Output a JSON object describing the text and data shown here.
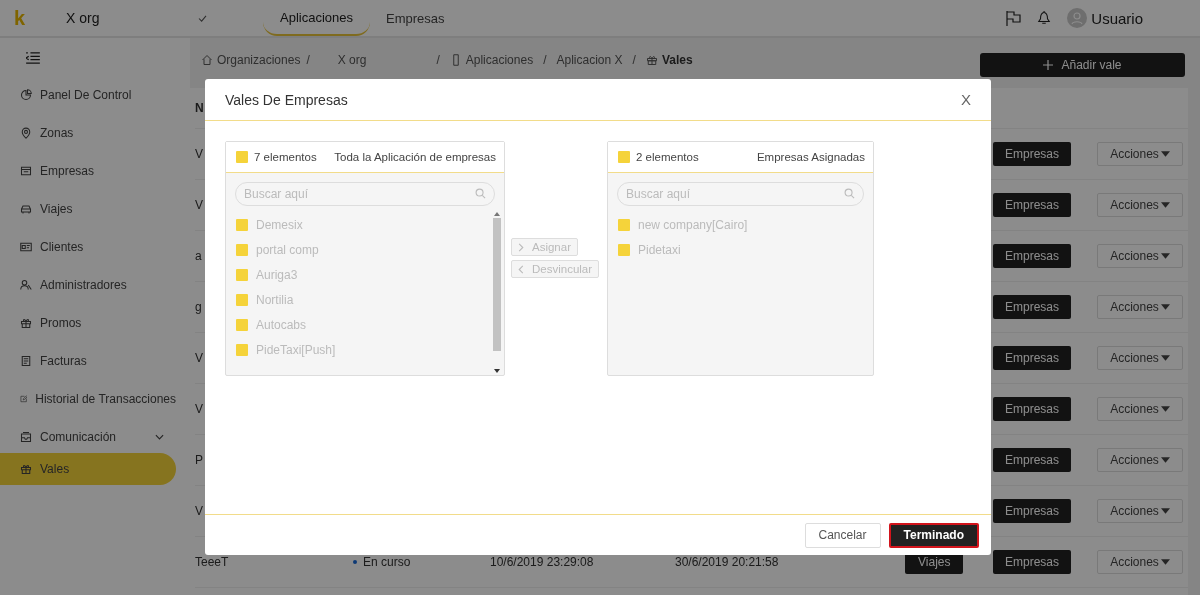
{
  "header": {
    "logo": "k",
    "org": "X org",
    "tabs": [
      {
        "label": "Aplicaciones",
        "selected": true
      },
      {
        "label": "Empresas",
        "selected": false
      }
    ],
    "user": "Usuario"
  },
  "sidebar": {
    "items": [
      {
        "label": "Panel De Control",
        "selected": false
      },
      {
        "label": "Zonas",
        "selected": false
      },
      {
        "label": "Empresas",
        "selected": false
      },
      {
        "label": "Viajes",
        "selected": false
      },
      {
        "label": "Clientes",
        "selected": false
      },
      {
        "label": "Administradores",
        "selected": false
      },
      {
        "label": "Promos",
        "selected": false
      },
      {
        "label": "Facturas",
        "selected": false
      },
      {
        "label": "Historial de Transacciones",
        "selected": false
      },
      {
        "label": "Comunicación",
        "selected": false,
        "expanded": false
      },
      {
        "label": "Vales",
        "selected": true
      }
    ]
  },
  "breadcrumb": [
    {
      "label": "Organizaciones",
      "separator": "/"
    },
    {
      "label": "X org",
      "separator": "/"
    },
    {
      "label": "Aplicaciones",
      "separator": "/"
    },
    {
      "label": "Aplicacion X",
      "separator": "/"
    },
    {
      "label": "Vales"
    }
  ],
  "add_button": "Añadir vale",
  "table": {
    "columns": [
      "N"
    ],
    "rows": [
      {
        "column_1": "V",
        "empresas": "Empresas",
        "acciones": "Acciones"
      },
      {
        "column_1": "V",
        "empresas": "Empresas",
        "acciones": "Acciones"
      },
      {
        "column_1": "a",
        "empresas": "Empresas",
        "acciones": "Acciones"
      },
      {
        "column_1": "g",
        "empresas": "Empresas",
        "acciones": "Acciones"
      },
      {
        "column_1": "V",
        "empresas": "Empresas",
        "acciones": "Acciones"
      },
      {
        "column_1": "V",
        "empresas": "Empresas",
        "acciones": "Acciones"
      },
      {
        "column_1": "P",
        "empresas": "Empresas",
        "acciones": "Acciones"
      },
      {
        "column_1": "V",
        "empresas": "Empresas",
        "acciones": "Acciones"
      },
      {
        "column_1": "TeeeT",
        "status": "En curso",
        "start": "10/6/2019 23:29:08",
        "end": "30/6/2019 20:21:58",
        "viajes": "Viajes",
        "empresas": "Empresas",
        "acciones": "Acciones"
      }
    ]
  },
  "modal": {
    "title": "Vales De Empresas",
    "close": "X",
    "source": {
      "checked": false,
      "count": "7 elementos",
      "title": "Toda la Aplicación de empresas",
      "placeholder": "Buscar aquí",
      "items": [
        "Demesix",
        "portal comp",
        "Auriga3",
        "Nortilia",
        "Autocabs",
        "PideTaxi[Push]"
      ]
    },
    "target": {
      "checked": false,
      "count": "2 elementos",
      "title": "Empresas Asignadas",
      "placeholder": "Buscar aquí",
      "items": [
        "new company[Cairo]",
        "Pidetaxi"
      ]
    },
    "actions": [
      {
        "label": "Asignar",
        "disabled": true,
        "kind": "right"
      },
      {
        "label": "Desvincular",
        "disabled": true,
        "kind": "left"
      }
    ],
    "buttons": [
      {
        "label": "Cancelar",
        "kind": "default",
        "focused": false
      },
      {
        "label": "Terminado",
        "kind": "primary",
        "focused": true
      }
    ]
  }
}
